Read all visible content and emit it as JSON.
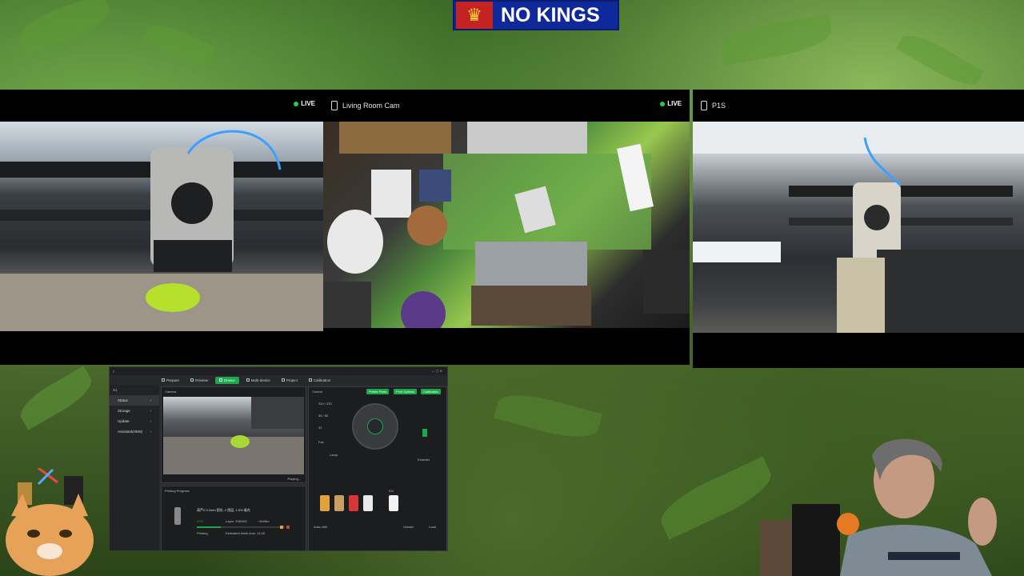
{
  "banner": {
    "text": "NO KINGS",
    "crown_glyph": "♛",
    "bg_color": "#10299a"
  },
  "cameras": [
    {
      "id": "cam-left",
      "title": "",
      "live": "LIVE"
    },
    {
      "id": "cam-center",
      "title": "Living Room Cam",
      "live": "LIVE"
    },
    {
      "id": "cam-right",
      "title": "P1S",
      "live": ""
    }
  ],
  "software": {
    "tabs": [
      "Prepare",
      "Preview",
      "Device",
      "Multi-device",
      "Project",
      "Calibration"
    ],
    "active_tab": "Device",
    "printer": "X1",
    "sidebar": [
      "Status",
      "Storage",
      "Update",
      "Assistant(HMS)"
    ],
    "camera_label": "Camera",
    "camera_status": "Playing...",
    "progress_title": "Printing Progress",
    "job_name": "葫芦2 0.2mm 图形, 2 图层, 1.5% 填充",
    "percent": "27%",
    "layer": "Layer: 108/400",
    "remaining": "~4h28m",
    "status": "Printing",
    "finish": "Estimated finish time: 14:40",
    "control_label": "Control",
    "control_buttons": [
      "Printer Parts",
      "Print Options",
      "Calibration"
    ],
    "temps": [
      "220 / 220",
      "55 / 55",
      "32"
    ],
    "fan_label": "Fan",
    "lamp_label": "Lamp",
    "extruder_label": "Extruder",
    "ext_label": "Ext",
    "ams_label": "Auto-refill",
    "bottom_buttons": [
      "Unload",
      "Load"
    ],
    "progress_fraction": 0.27
  }
}
